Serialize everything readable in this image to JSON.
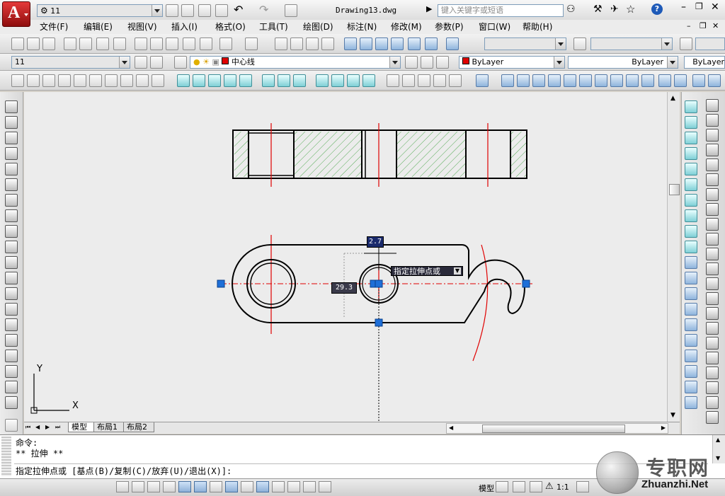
{
  "app": {
    "logo_letter": "A",
    "file_title": "Drawing13.dwg",
    "search_placeholder": "键入关键字或短语",
    "workspace_value": "11"
  },
  "menu": [
    "文件(F)",
    "编辑(E)",
    "视图(V)",
    "插入(I)",
    "格式(O)",
    "工具(T)",
    "绘图(D)",
    "标注(N)",
    "修改(M)",
    "参数(P)",
    "窗口(W)",
    "帮助(H)"
  ],
  "layers": {
    "layer_combo_value": "11",
    "current_layer": "中心线",
    "color_value": "ByLayer",
    "linetype_value": "ByLayer",
    "lineweight_value": "ByLayer",
    "current_layer_color": "#e00000"
  },
  "drawing": {
    "dim_top_value": "2.7",
    "dim_left_value": "29.3",
    "tooltip_text": "指定拉伸点或",
    "grip_color": "#1e6fd8",
    "centerline_color": "#e00000",
    "hatch_color": "#2f9a2f",
    "ucs_x": "X",
    "ucs_y": "Y"
  },
  "layout_tabs": [
    {
      "label": "模型",
      "active": true
    },
    {
      "label": "布局1",
      "active": false
    },
    {
      "label": "布局2",
      "active": false
    }
  ],
  "command": {
    "line1": "命令:",
    "line2": "** 拉伸 **",
    "prompt": "指定拉伸点或 [基点(B)/复制(C)/放弃(U)/退出(X)]:"
  },
  "status": {
    "model_label": "模型",
    "scale_label": "1:1"
  },
  "watermark": {
    "brand": "专职网",
    "url": "Zhuanzhi.Net"
  }
}
